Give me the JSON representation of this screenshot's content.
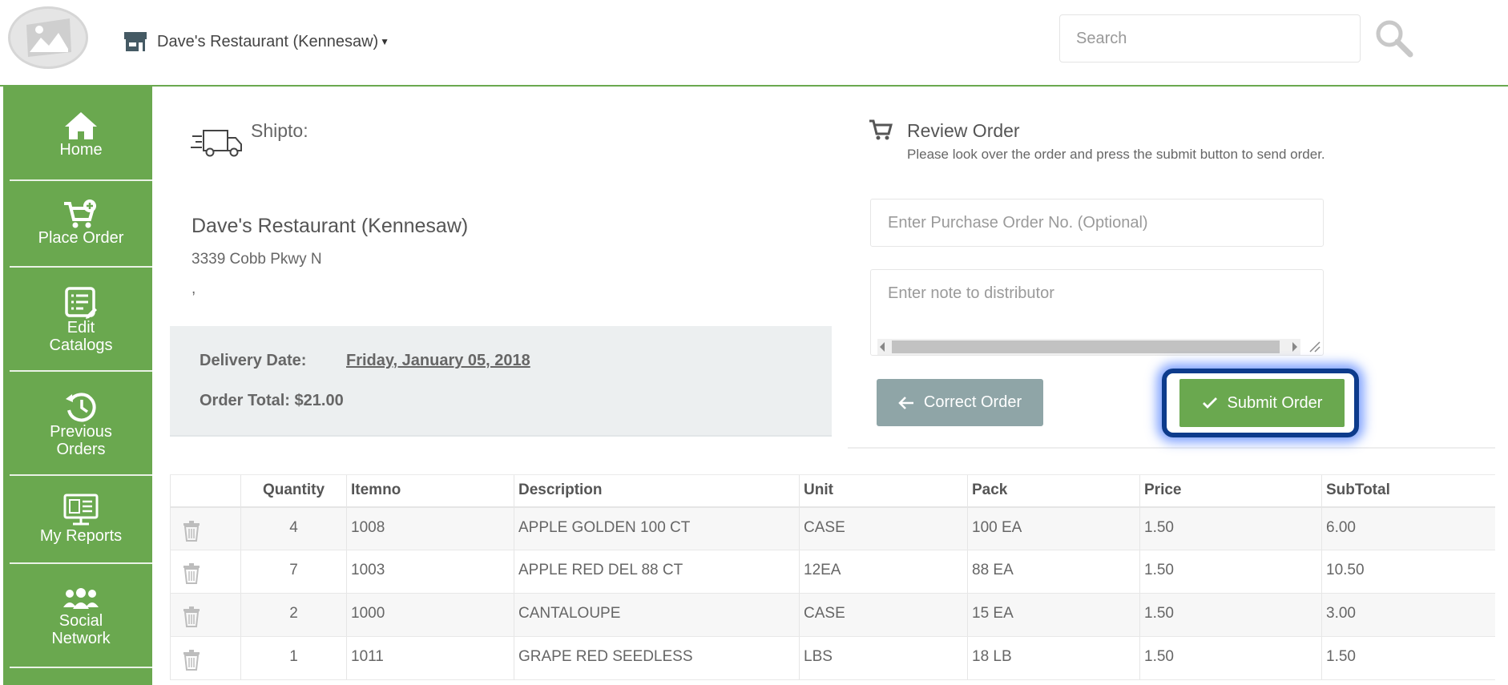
{
  "header": {
    "store_name": "Dave's Restaurant (Kennesaw)",
    "search_placeholder": "Search"
  },
  "sidebar": {
    "items": [
      {
        "label": "Home",
        "icon": "home-icon"
      },
      {
        "label": "Place Order",
        "icon": "cart-add-icon"
      },
      {
        "label_line1": "Edit",
        "label_line2": "Catalogs",
        "icon": "catalog-icon"
      },
      {
        "label_line1": "Previous",
        "label_line2": "Orders",
        "icon": "history-icon"
      },
      {
        "label": "My Reports",
        "icon": "reports-icon"
      },
      {
        "label_line1": "Social",
        "label_line2": "Network",
        "icon": "people-icon"
      }
    ],
    "color": "#6aa84f"
  },
  "shipto": {
    "label": "Shipto:",
    "name": "Dave's Restaurant (Kennesaw)",
    "address": "3339 Cobb Pkwy N",
    "city_line": ",",
    "delivery_label": "Delivery Date:",
    "delivery_value": "Friday, January 05, 2018",
    "order_total": "Order Total: $21.00"
  },
  "review": {
    "title": "Review Order",
    "subtitle": "Please look over the order and press the submit button to send order.",
    "po_placeholder": "Enter Purchase Order No. (Optional)",
    "note_placeholder": "Enter note to distributor",
    "correct_label": "Correct Order",
    "submit_label": "Submit Order"
  },
  "table": {
    "columns": [
      "Quantity",
      "Itemno",
      "Description",
      "Unit",
      "Pack",
      "Price",
      "SubTotal"
    ],
    "rows": [
      {
        "qty": "4",
        "itemno": "1008",
        "desc": "APPLE GOLDEN 100 CT",
        "unit": "CASE",
        "pack": "100 EA",
        "price": "1.50",
        "subtotal": "6.00"
      },
      {
        "qty": "7",
        "itemno": "1003",
        "desc": "APPLE RED DEL 88 CT",
        "unit": "12EA",
        "pack": "88 EA",
        "price": "1.50",
        "subtotal": "10.50"
      },
      {
        "qty": "2",
        "itemno": "1000",
        "desc": "CANTALOUPE",
        "unit": "CASE",
        "pack": "15 EA",
        "price": "1.50",
        "subtotal": "3.00"
      },
      {
        "qty": "1",
        "itemno": "1011",
        "desc": "GRAPE RED SEEDLESS",
        "unit": "LBS",
        "pack": "18 LB",
        "price": "1.50",
        "subtotal": "1.50"
      }
    ]
  }
}
